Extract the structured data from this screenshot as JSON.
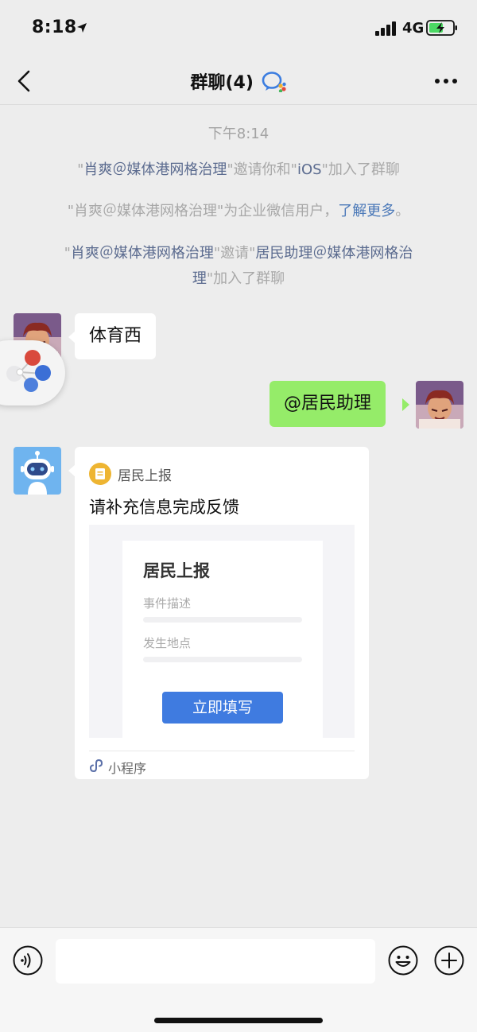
{
  "status_bar": {
    "time": "8:18",
    "network": "4G"
  },
  "nav": {
    "title": "群聊(4)"
  },
  "system": {
    "time": "下午8:14",
    "msg1": {
      "q1": "\"",
      "name1": "肖爽＠媒体港网格治理",
      "q2": "\"邀请你和\"",
      "name2": "iOS",
      "q3": "\"加入了群聊"
    },
    "msg2": {
      "q1": "\"",
      "name1": "肖爽＠媒体港网格治理",
      "q2": "\"为企业微信用户，",
      "link": "了解更多",
      "end": "。"
    },
    "msg3": {
      "q1": "\"",
      "name1": "肖爽＠媒体港网格治理",
      "q2": "\"邀请\"",
      "name2": "居民助理＠媒体港网格治",
      "line2_name": "理",
      "q3": "\"加入了群聊"
    }
  },
  "messages": {
    "m1": "体育西",
    "m2": "@居民助理"
  },
  "mini_program": {
    "app_name": "居民上报",
    "title": "请补充信息完成反馈",
    "preview_title": "居民上报",
    "field1": "事件描述",
    "field2": "发生地点",
    "button": "立即填写",
    "footer": "小程序"
  },
  "colors": {
    "wechat_green": "#95ec69",
    "link_blue": "#4a78b8",
    "button_blue": "#3f7be0"
  }
}
